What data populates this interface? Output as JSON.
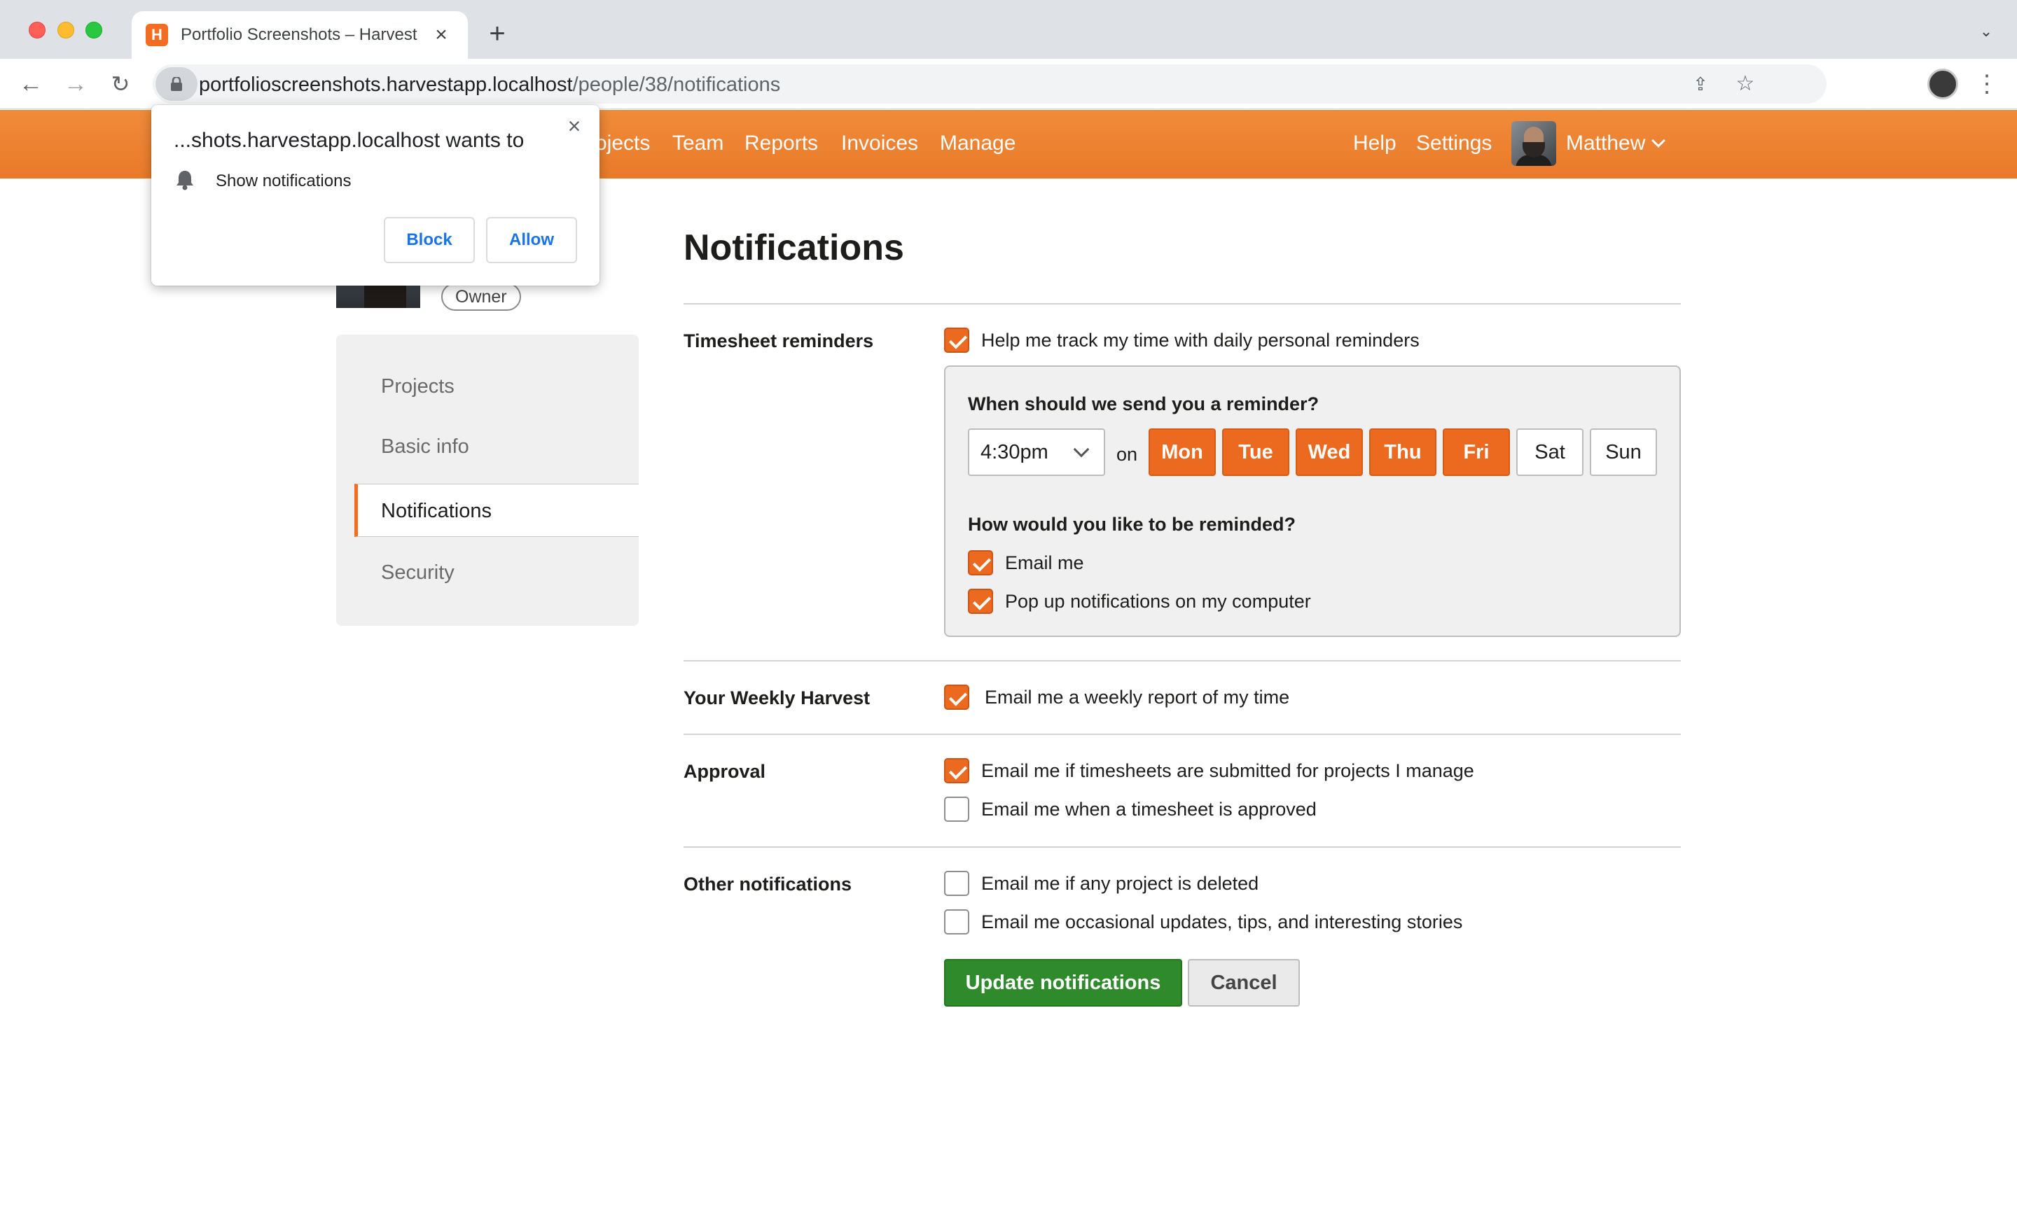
{
  "browser": {
    "tab_title": "Portfolio Screenshots – Harvest",
    "tab_favicon": "H",
    "url_host": "portfolioscreenshots.harvestapp.localhost",
    "url_path": "/people/38/notifications"
  },
  "appnav": {
    "links": [
      "Projects",
      "Team",
      "Reports",
      "Invoices",
      "Manage"
    ],
    "help": "Help",
    "settings": "Settings",
    "user": "Matthew"
  },
  "permission_popup": {
    "title": "...shots.harvestapp.localhost wants to",
    "item": "Show notifications",
    "block": "Block",
    "allow": "Allow"
  },
  "profile": {
    "badge": "Owner"
  },
  "sidenav": {
    "items": [
      "Projects",
      "Basic info",
      "Notifications",
      "Security"
    ],
    "active": "Notifications"
  },
  "page": {
    "title": "Notifications"
  },
  "timesheet_reminders": {
    "label": "Timesheet reminders",
    "enable": {
      "text": "Help me track my time with daily personal reminders",
      "checked": true
    },
    "when_question": "When should we send you a reminder?",
    "time": "4:30pm",
    "on": "on",
    "days": [
      {
        "label": "Mon",
        "selected": true
      },
      {
        "label": "Tue",
        "selected": true
      },
      {
        "label": "Wed",
        "selected": true
      },
      {
        "label": "Thu",
        "selected": true
      },
      {
        "label": "Fri",
        "selected": true
      },
      {
        "label": "Sat",
        "selected": false
      },
      {
        "label": "Sun",
        "selected": false
      }
    ],
    "how_question": "How would you like to be reminded?",
    "email": {
      "text": "Email me",
      "checked": true
    },
    "popup": {
      "text": "Pop up notifications on my computer",
      "checked": true
    }
  },
  "weekly_harvest": {
    "label": "Your Weekly Harvest",
    "option": {
      "text": "Email me a weekly report of my time",
      "checked": true
    }
  },
  "approval": {
    "label": "Approval",
    "submitted": {
      "text": "Email me if timesheets are submitted for projects I manage",
      "checked": true
    },
    "approved": {
      "text": "Email me when a timesheet is approved",
      "checked": false
    }
  },
  "other": {
    "label": "Other notifications",
    "deleted": {
      "text": "Email me if any project is deleted",
      "checked": false
    },
    "updates": {
      "text": "Email me occasional updates, tips, and interesting stories",
      "checked": false
    }
  },
  "actions": {
    "update": "Update notifications",
    "cancel": "Cancel"
  },
  "colors": {
    "brand_orange": "#ec6a1f",
    "primary_green": "#2f8a2b"
  }
}
